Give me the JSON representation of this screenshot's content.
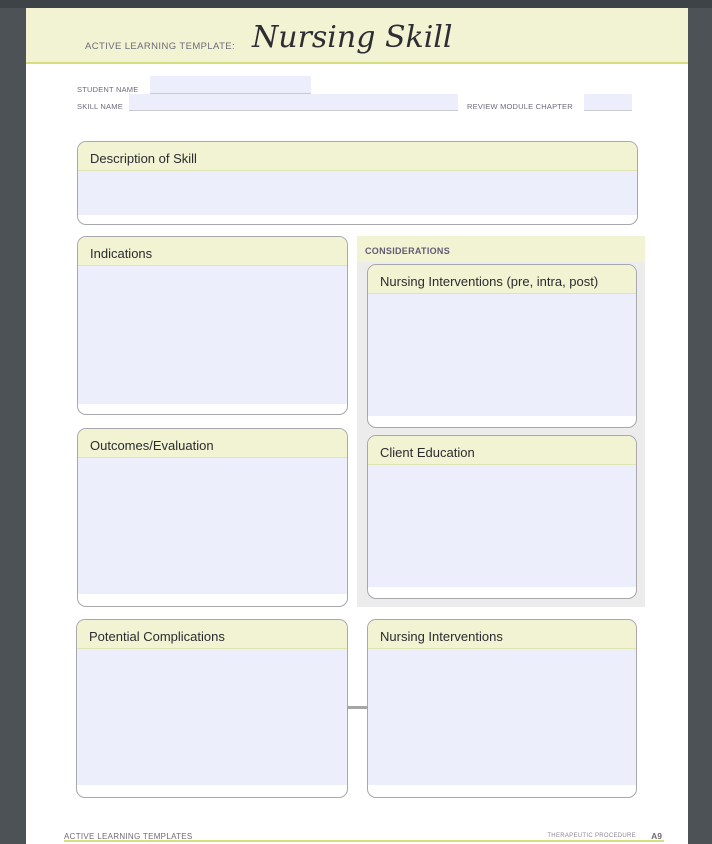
{
  "header": {
    "prefix": "ACTIVE LEARNING TEMPLATE:",
    "title": "Nursing Skill"
  },
  "fields": {
    "student_name_label": "STUDENT NAME",
    "skill_name_label": "SKILL NAME",
    "review_module_label": "REVIEW MODULE CHAPTER"
  },
  "sections": {
    "description": "Description of Skill",
    "indications": "Indications",
    "outcomes": "Outcomes/Evaluation",
    "considerations": "CONSIDERATIONS",
    "nursing_interventions_phases": "Nursing Interventions (pre, intra, post)",
    "client_education": "Client Education",
    "potential_complications": "Potential Complications",
    "nursing_interventions": "Nursing Interventions"
  },
  "footer": {
    "left": "ACTIVE LEARNING TEMPLATES",
    "right": "THERAPEUTIC PROCEDURE",
    "page": "A9"
  },
  "colors": {
    "header_fill": "#f1f3d3",
    "accent_line": "#d7de7d",
    "field_fill": "#edeefb",
    "page_background": "#4d5256"
  }
}
